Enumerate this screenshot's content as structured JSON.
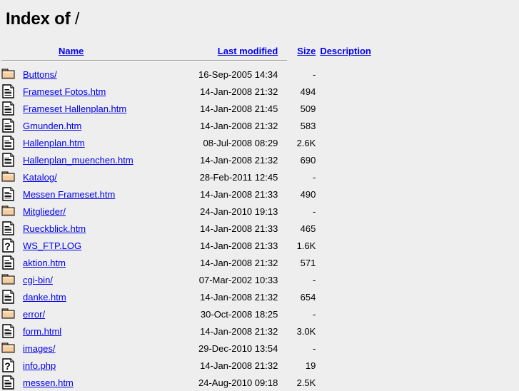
{
  "page": {
    "title_prefix": "Index of",
    "root_path": "/",
    "background": "#eeeeee",
    "link_color": "#0000ee"
  },
  "columns": {
    "icon": "",
    "name": "Name",
    "last_modified": "Last modified",
    "size": "Size",
    "description": "Description"
  },
  "entries": [
    {
      "icon": "folder-icon",
      "name": "Buttons/",
      "last_modified": "16-Sep-2005 14:34",
      "size": "-",
      "description": ""
    },
    {
      "icon": "document-icon",
      "name": "Frameset Fotos.htm",
      "last_modified": "14-Jan-2008 21:32",
      "size": "494",
      "description": ""
    },
    {
      "icon": "document-icon",
      "name": "Frameset Hallenplan.htm",
      "last_modified": "14-Jan-2008 21:45",
      "size": "509",
      "description": ""
    },
    {
      "icon": "document-icon",
      "name": "Gmunden.htm",
      "last_modified": "14-Jan-2008 21:32",
      "size": "583",
      "description": ""
    },
    {
      "icon": "document-icon",
      "name": "Hallenplan.htm",
      "last_modified": "08-Jul-2008 08:29",
      "size": "2.6K",
      "description": ""
    },
    {
      "icon": "document-icon",
      "name": "Hallenplan_muenchen.htm",
      "last_modified": "14-Jan-2008 21:32",
      "size": "690",
      "description": ""
    },
    {
      "icon": "folder-icon",
      "name": "Katalog/",
      "last_modified": "28-Feb-2011 12:45",
      "size": "-",
      "description": ""
    },
    {
      "icon": "document-icon",
      "name": "Messen Frameset.htm",
      "last_modified": "14-Jan-2008 21:33",
      "size": "490",
      "description": ""
    },
    {
      "icon": "folder-icon",
      "name": "Mitglieder/",
      "last_modified": "24-Jan-2010 19:13",
      "size": "-",
      "description": ""
    },
    {
      "icon": "document-icon",
      "name": "Rueckblick.htm",
      "last_modified": "14-Jan-2008 21:33",
      "size": "465",
      "description": ""
    },
    {
      "icon": "unknown-icon",
      "name": "WS_FTP.LOG",
      "last_modified": "14-Jan-2008 21:33",
      "size": "1.6K",
      "description": ""
    },
    {
      "icon": "document-icon",
      "name": "aktion.htm",
      "last_modified": "14-Jan-2008 21:32",
      "size": "571",
      "description": ""
    },
    {
      "icon": "folder-icon",
      "name": "cgi-bin/",
      "last_modified": "07-Mar-2002 10:33",
      "size": "-",
      "description": ""
    },
    {
      "icon": "document-icon",
      "name": "danke.htm",
      "last_modified": "14-Jan-2008 21:32",
      "size": "654",
      "description": ""
    },
    {
      "icon": "folder-icon",
      "name": "error/",
      "last_modified": "30-Oct-2008 18:25",
      "size": "-",
      "description": ""
    },
    {
      "icon": "document-icon",
      "name": "form.html",
      "last_modified": "14-Jan-2008 21:32",
      "size": "3.0K",
      "description": ""
    },
    {
      "icon": "folder-icon",
      "name": "images/",
      "last_modified": "29-Dec-2010 13:54",
      "size": "-",
      "description": ""
    },
    {
      "icon": "unknown-icon",
      "name": "info.php",
      "last_modified": "14-Jan-2008 21:32",
      "size": "19",
      "description": ""
    },
    {
      "icon": "document-icon",
      "name": "messen.htm",
      "last_modified": "24-Aug-2010 09:18",
      "size": "2.5K",
      "description": ""
    }
  ]
}
